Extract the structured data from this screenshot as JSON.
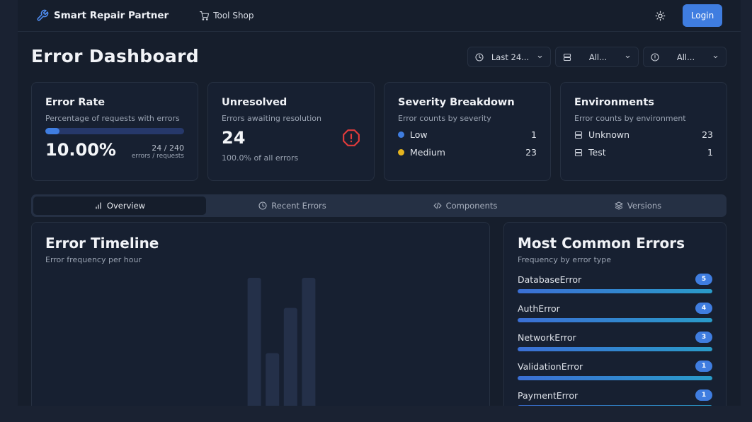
{
  "header": {
    "brand": "Smart Repair Partner",
    "brand_icon": "wrench-icon",
    "nav_link": "Tool Shop",
    "nav_icon": "cart-icon",
    "theme_icon": "sun-icon",
    "login": "Login"
  },
  "page": {
    "title": "Error Dashboard"
  },
  "filters": [
    {
      "icon": "clock-icon",
      "value": "Last 24..."
    },
    {
      "icon": "server-icon",
      "value": "All..."
    },
    {
      "icon": "alert-circle-icon",
      "value": "All..."
    }
  ],
  "cards": {
    "error_rate": {
      "title": "Error Rate",
      "subtitle": "Percentage of requests with errors",
      "value": "10.00%",
      "fraction": 0.1,
      "ratio": "24 / 240",
      "ratio_label": "errors / requests"
    },
    "unresolved": {
      "title": "Unresolved",
      "subtitle": "Errors awaiting resolution",
      "value": "24",
      "note": "100.0% of all errors",
      "icon": "alert-octagon-icon"
    },
    "severity": {
      "title": "Severity Breakdown",
      "subtitle": "Error counts by severity",
      "items": [
        {
          "label": "Low",
          "count": "1",
          "color": "#3f7de0"
        },
        {
          "label": "Medium",
          "count": "23",
          "color": "#e5b41f"
        }
      ]
    },
    "environments": {
      "title": "Environments",
      "subtitle": "Error counts by environment",
      "items": [
        {
          "label": "Unknown",
          "count": "23",
          "icon": "server-icon"
        },
        {
          "label": "Test",
          "count": "1",
          "icon": "server-icon"
        }
      ]
    }
  },
  "tabs": [
    {
      "label": "Overview",
      "icon": "bar-chart-icon",
      "active": true
    },
    {
      "label": "Recent Errors",
      "icon": "clock-icon",
      "active": false
    },
    {
      "label": "Components",
      "icon": "code-icon",
      "active": false
    },
    {
      "label": "Versions",
      "icon": "layers-icon",
      "active": false
    }
  ],
  "timeline": {
    "title": "Error Timeline",
    "subtitle": "Error frequency per hour"
  },
  "common_errors": {
    "title": "Most Common Errors",
    "subtitle": "Frequency by error type",
    "items": [
      {
        "name": "DatabaseError",
        "count": "5"
      },
      {
        "name": "AuthError",
        "count": "4"
      },
      {
        "name": "NetworkError",
        "count": "3"
      },
      {
        "name": "ValidationError",
        "count": "1"
      },
      {
        "name": "PaymentError",
        "count": "1"
      }
    ]
  },
  "chart_data": {
    "type": "bar",
    "bar_color": "#243049",
    "values": [
      0,
      0,
      0,
      0,
      0,
      0,
      0,
      0,
      0,
      0,
      0,
      9,
      4,
      7,
      9,
      0,
      0,
      0,
      0,
      0,
      0,
      0,
      0,
      0
    ]
  }
}
